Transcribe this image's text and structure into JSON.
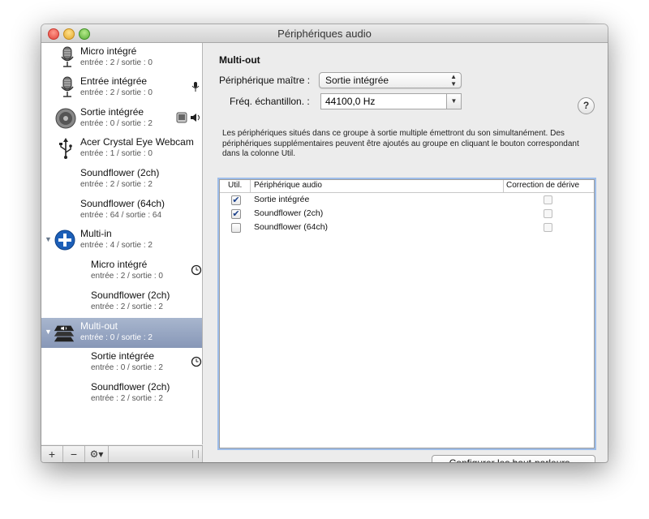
{
  "window": {
    "title": "Périphériques audio"
  },
  "devices": [
    {
      "name": "Micro intégré",
      "io": "entrée : 2 / sortie : 0",
      "icon": "microphone-icon",
      "right_icons": []
    },
    {
      "name": "Entrée intégrée",
      "io": "entrée : 2 / sortie : 0",
      "icon": "microphone-icon",
      "right_icons": [
        "small-mic-icon"
      ]
    },
    {
      "name": "Sortie intégrée",
      "io": "entrée : 0 / sortie : 2",
      "icon": "speaker-icon",
      "right_icons": [
        "finder-icon",
        "speaker-small-icon"
      ]
    },
    {
      "name": "Acer Crystal Eye Webcam",
      "io": "entrée : 1 / sortie : 0",
      "icon": "usb-icon",
      "right_icons": []
    },
    {
      "name": "Soundflower (2ch)",
      "io": "entrée : 2 / sortie : 2",
      "icon": "",
      "right_icons": []
    },
    {
      "name": "Soundflower (64ch)",
      "io": "entrée : 64 / sortie : 64",
      "icon": "",
      "right_icons": []
    },
    {
      "name": "Multi-in",
      "io": "entrée : 4 / sortie : 2",
      "icon": "aggregate-plus-icon",
      "expanded": true
    },
    {
      "name": "Micro intégré",
      "io": "entrée : 2 / sortie : 0",
      "indent": true,
      "right_icons": [
        "clock-icon"
      ]
    },
    {
      "name": "Soundflower (2ch)",
      "io": "entrée : 2 / sortie : 2",
      "indent": true
    },
    {
      "name": "Multi-out",
      "io": "entrée : 0 / sortie : 2",
      "icon": "multi-output-icon",
      "expanded": true,
      "selected": true
    },
    {
      "name": "Sortie intégrée",
      "io": "entrée : 0 / sortie : 2",
      "indent": true,
      "right_icons": [
        "clock-icon"
      ]
    },
    {
      "name": "Soundflower (2ch)",
      "io": "entrée : 2 / sortie : 2",
      "indent": true
    }
  ],
  "bottom_bar": {
    "add": "+",
    "remove": "−",
    "gear": "⚙▾"
  },
  "detail": {
    "heading": "Multi-out",
    "master_label": "Périphérique maître :",
    "master_value": "Sortie intégrée",
    "rate_label": "Fréq. échantillon. :",
    "rate_value": "44100,0 Hz",
    "help": "?",
    "description": "Les périphériques situés dans ce groupe à sortie multiple émettront du son simultanément. Des périphériques supplémentaires peuvent être ajoutés au groupe en cliquant le bouton correspondant dans la colonne Util.",
    "table": {
      "headers": [
        "Util.",
        "Périphérique audio",
        "Correction de dérive"
      ],
      "rows": [
        {
          "use": true,
          "device": "Sortie intégrée",
          "drift": false
        },
        {
          "use": true,
          "device": "Soundflower (2ch)",
          "drift": false
        },
        {
          "use": false,
          "device": "Soundflower (64ch)",
          "drift": false
        }
      ]
    },
    "configure_button": "Configurer les haut-parleurs..."
  },
  "colors": {
    "selection": "#8f9fbd",
    "accent": "#1a5fb4",
    "focus_ring": "#9ebde9"
  }
}
